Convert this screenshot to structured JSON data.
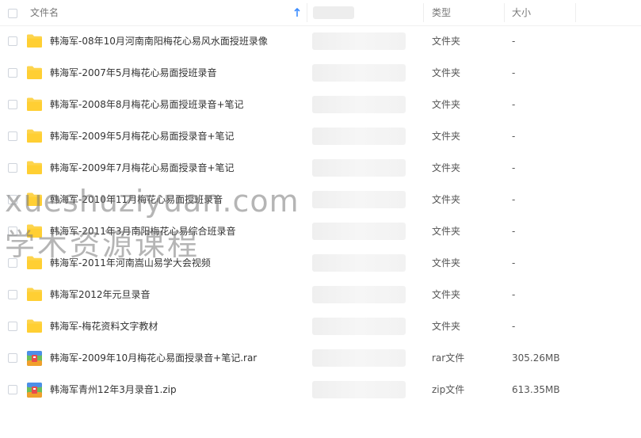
{
  "header": {
    "name_label": "文件名",
    "type_label": "类型",
    "size_label": "大小",
    "sort_icon": "arrow-up-icon"
  },
  "rows": [
    {
      "name": "韩海军-08年10月河南南阳梅花心易风水面授班录像",
      "type": "文件夹",
      "size": "-",
      "icon": "folder-icon"
    },
    {
      "name": "韩海军-2007年5月梅花心易面授班录音",
      "type": "文件夹",
      "size": "-",
      "icon": "folder-icon"
    },
    {
      "name": "韩海军-2008年8月梅花心易面授班录音+笔记",
      "type": "文件夹",
      "size": "-",
      "icon": "folder-icon"
    },
    {
      "name": "韩海军-2009年5月梅花心易面授录音+笔记",
      "type": "文件夹",
      "size": "-",
      "icon": "folder-icon"
    },
    {
      "name": "韩海军-2009年7月梅花心易面授录音+笔记",
      "type": "文件夹",
      "size": "-",
      "icon": "folder-icon"
    },
    {
      "name": "韩海军-2010年11月梅花心易面授班录音",
      "type": "文件夹",
      "size": "-",
      "icon": "folder-icon"
    },
    {
      "name": "韩海军-2011年3月南阳梅花心易综合班录音",
      "type": "文件夹",
      "size": "-",
      "icon": "folder-icon"
    },
    {
      "name": "韩海军-2011年河南嵩山易学大会视频",
      "type": "文件夹",
      "size": "-",
      "icon": "folder-icon"
    },
    {
      "name": "韩海军2012年元旦录音",
      "type": "文件夹",
      "size": "-",
      "icon": "folder-icon"
    },
    {
      "name": "韩海军-梅花资料文字教材",
      "type": "文件夹",
      "size": "-",
      "icon": "folder-icon"
    },
    {
      "name": "韩海军-2009年10月梅花心易面授录音+笔记.rar",
      "type": "rar文件",
      "size": "305.26MB",
      "icon": "archive-icon"
    },
    {
      "name": "韩海军青州12年3月录音1.zip",
      "type": "zip文件",
      "size": "613.35MB",
      "icon": "archive-icon"
    }
  ],
  "watermark": {
    "line1": "xueshuziyuan.com",
    "line2": "学术资源课程"
  },
  "colors": {
    "folder": "#fdd44d",
    "accent": "#3b8cff",
    "watermark": "#787878"
  }
}
